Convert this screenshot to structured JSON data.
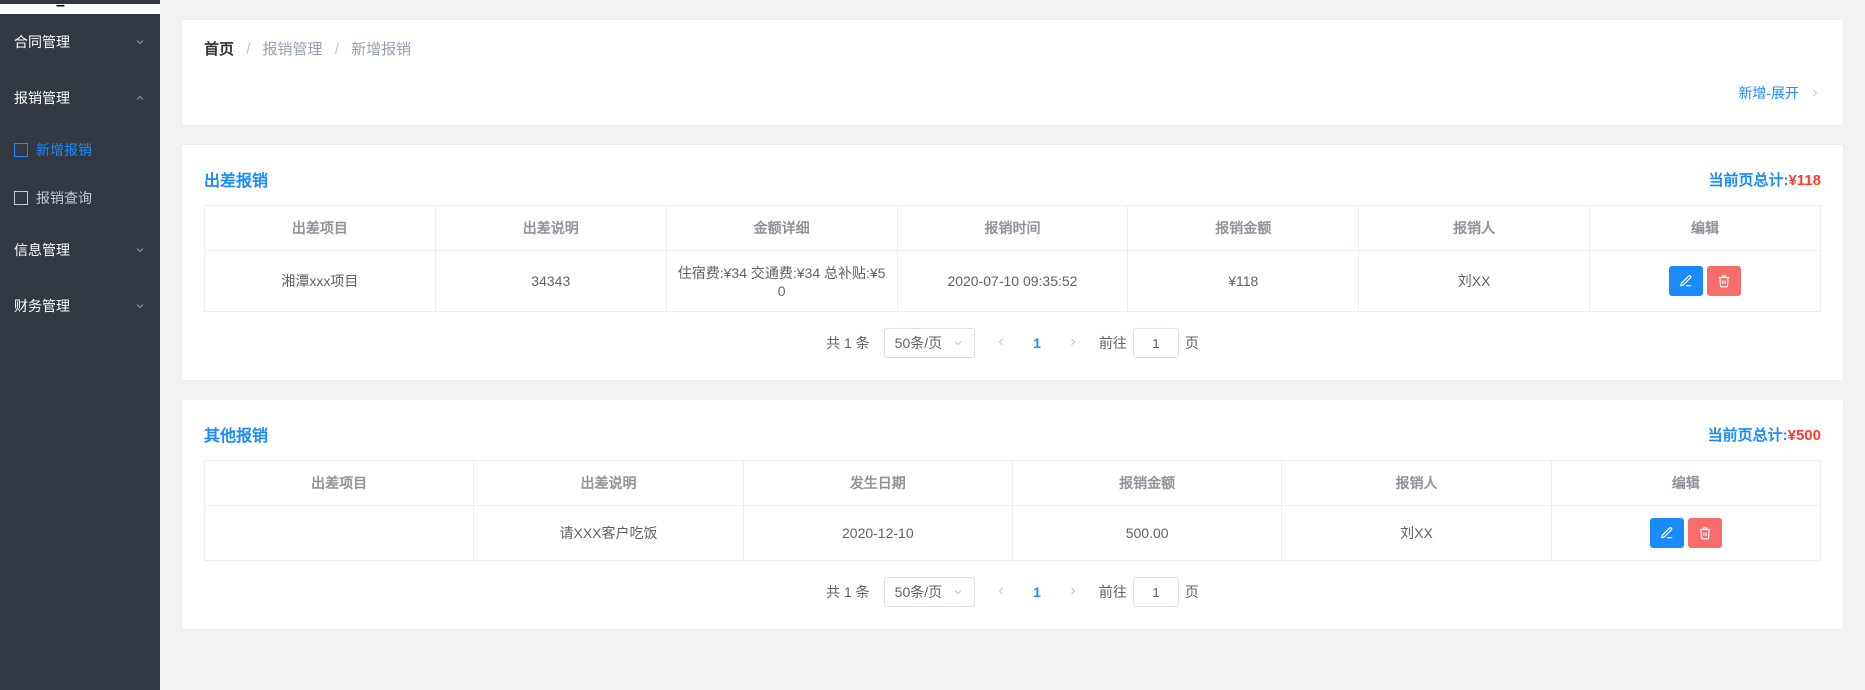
{
  "sidebar": {
    "items": [
      {
        "label": "合同管理",
        "expanded": false
      },
      {
        "label": "报销管理",
        "expanded": true,
        "children": [
          {
            "label": "新增报销",
            "active": true
          },
          {
            "label": "报销查询",
            "active": false
          }
        ]
      },
      {
        "label": "信息管理",
        "expanded": false
      },
      {
        "label": "财务管理",
        "expanded": false
      }
    ]
  },
  "breadcrumb": {
    "home": "首页",
    "level1": "报销管理",
    "level2": "新增报销",
    "expand_label": "新增-展开"
  },
  "section1": {
    "title": "出差报销",
    "total_label": "当前页总计:",
    "total_value": "¥118",
    "columns": [
      "出差项目",
      "出差说明",
      "金额详细",
      "报销时间",
      "报销金额",
      "报销人",
      "编辑"
    ],
    "rows": [
      {
        "project": "湘潭xxx项目",
        "desc": "34343",
        "detail": "住宿费:¥34 交通费:¥34 总补贴:¥50",
        "time": "2020-07-10 09:35:52",
        "amount": "¥118",
        "person": "刘XX"
      }
    ],
    "pager": {
      "total_text": "共 1 条",
      "page_size": "50条/页",
      "current": "1",
      "goto_label_pre": "前往",
      "goto_value": "1",
      "goto_label_post": "页"
    }
  },
  "section2": {
    "title": "其他报销",
    "total_label": "当前页总计:",
    "total_value": "¥500",
    "columns": [
      "出差项目",
      "出差说明",
      "发生日期",
      "报销金额",
      "报销人",
      "编辑"
    ],
    "rows": [
      {
        "project": "",
        "desc": "请XXX客户吃饭",
        "date": "2020-12-10",
        "amount": "500.00",
        "person": "刘XX"
      }
    ],
    "pager": {
      "total_text": "共 1 条",
      "page_size": "50条/页",
      "current": "1",
      "goto_label_pre": "前往",
      "goto_value": "1",
      "goto_label_post": "页"
    }
  }
}
